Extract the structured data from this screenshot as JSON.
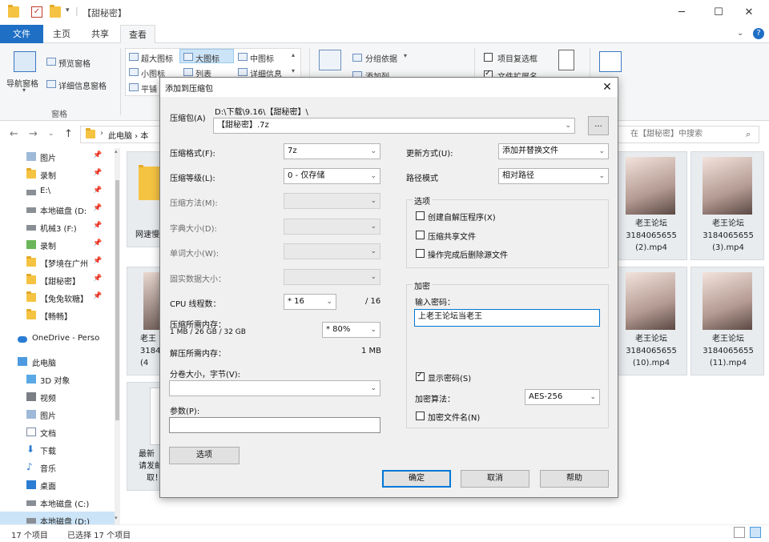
{
  "explorer": {
    "title": "【甜秘密】",
    "tabs": [
      "文件",
      "主页",
      "共享",
      "查看"
    ],
    "ribbon": {
      "pane": {
        "nav_pane": "导航窗格",
        "preview": "预览窗格",
        "details": "详细信息窗格",
        "group_label": "窗格"
      },
      "layout": {
        "xl_icons": "超大图标",
        "large_icons": "大图标",
        "medium_icons": "中图标",
        "small_icons": "小图标",
        "list": "列表",
        "details": "详细信息",
        "tiles": "平铺"
      },
      "view": {
        "group_by": "分组依据",
        "add_col": "添加列"
      },
      "show": {
        "item_checkbox": "项目复选框",
        "file_ext": "文件扩展名"
      }
    },
    "address": {
      "path": "此电脑 › 本",
      "search_placeholder": "在【甜秘密】中搜索"
    },
    "nav_items": [
      {
        "label": "图片",
        "pin": "📌"
      },
      {
        "label": "录制",
        "pin": "📌"
      },
      {
        "label": "E:\\",
        "pin": "📌"
      },
      {
        "label": "本地磁盘 (D:",
        "pin": "📌"
      },
      {
        "label": "机械3 (F:)",
        "pin": "📌"
      },
      {
        "label": "录制",
        "pin": "📌"
      },
      {
        "label": "【梦境在广州",
        "pin": "📌"
      },
      {
        "label": "【甜秘密】",
        "pin": "📌"
      },
      {
        "label": "【兔兔软糖】",
        "pin": "📌"
      },
      {
        "label": "【畅畅】",
        "pin": ""
      },
      {
        "label": "OneDrive - Perso",
        "pin": ""
      },
      {
        "label": "此电脑",
        "pin": ""
      },
      {
        "label": "3D 对象",
        "pin": ""
      },
      {
        "label": "视频",
        "pin": ""
      },
      {
        "label": "图片",
        "pin": ""
      },
      {
        "label": "文档",
        "pin": ""
      },
      {
        "label": "下载",
        "pin": ""
      },
      {
        "label": "音乐",
        "pin": ""
      },
      {
        "label": "桌面",
        "pin": ""
      },
      {
        "label": "本地磁盘 (C:)",
        "pin": ""
      },
      {
        "label": "本地磁盘 (D:)",
        "pin": ""
      }
    ],
    "content": {
      "left_folder": "网速慢",
      "left_thumbs": [
        {
          "l1": "老王",
          "l2": "3184",
          "l3": "(4"
        },
        {
          "l1": "最新",
          "l2": "请发邮",
          "l3": "取！"
        }
      ],
      "thumbs": [
        {
          "l1": "老王论坛",
          "l2": "3184065655",
          "l3": "(2).mp4"
        },
        {
          "l1": "老王论坛",
          "l2": "3184065655",
          "l3": "(3).mp4"
        },
        {
          "l1": "老王论坛",
          "l2": "3184065655",
          "l3": "(10).mp4"
        },
        {
          "l1": "老王论坛",
          "l2": "3184065655",
          "l3": "(11).mp4"
        }
      ]
    },
    "status": {
      "count": "17 个项目",
      "selected": "已选择 17 个项目"
    }
  },
  "dialog": {
    "title": "添加到压缩包",
    "archive_label": "压缩包(A)",
    "archive_dir": "D:\\下载\\9.16\\【甜秘密】\\",
    "archive_name": "【甜秘密】.7z",
    "browse": "...",
    "format_label": "压缩格式(F):",
    "format_value": "7z",
    "level_label": "压缩等级(L):",
    "level_value": "0 - 仅存储",
    "method_label": "压缩方法(M):",
    "dict_label": "字典大小(D):",
    "word_label": "单词大小(W):",
    "solid_label": "固实数据大小：",
    "cpu_label": "CPU 线程数：",
    "cpu_value": "* 16",
    "cpu_total": "/ 16",
    "mem_comp_label": "压缩所需内存：",
    "mem_comp_detail": "1 MB / 26 GB / 32 GB",
    "mem_comp_value": "* 80%",
    "mem_decomp_label": "解压所需内存：",
    "mem_decomp_value": "1 MB",
    "split_label": "分卷大小，字节(V):",
    "params_label": "参数(P):",
    "options_btn": "选项",
    "update_label": "更新方式(U):",
    "update_value": "添加并替换文件",
    "path_label": "路径模式",
    "path_value": "相对路径",
    "options_group": "选项",
    "opt_sfx": "创建自解压程序(X)",
    "opt_shared": "压缩共享文件",
    "opt_delete": "操作完成后删除源文件",
    "encrypt_group": "加密",
    "pwd_label": "输入密码：",
    "pwd_value": "上老王论坛当老王",
    "show_pwd": "显示密码(S)",
    "enc_method_label": "加密算法：",
    "enc_method_value": "AES-256",
    "enc_names": "加密文件名(N)",
    "ok": "确定",
    "cancel": "取消",
    "help": "帮助"
  }
}
